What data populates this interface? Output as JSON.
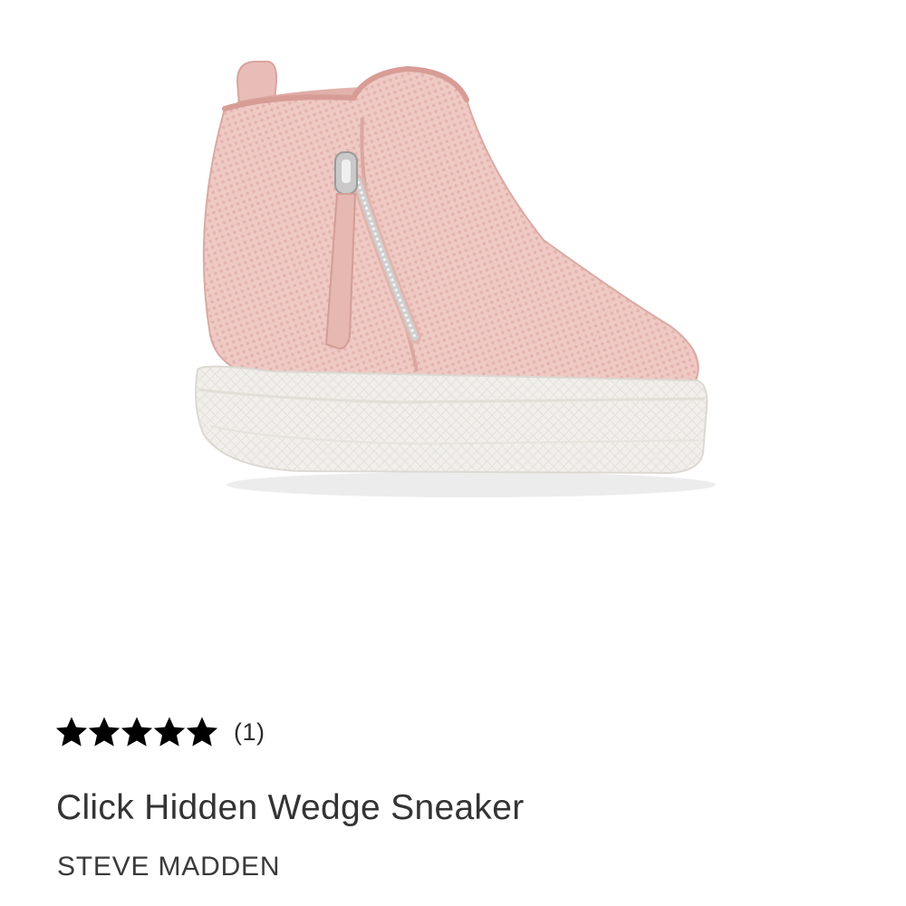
{
  "product": {
    "image_icon": "pink-wedge-sneaker-photo",
    "rating": {
      "value": 5,
      "max": 5,
      "icon": "star-icon",
      "review_count_label": "(1)"
    },
    "title": "Click Hidden Wedge Sneaker",
    "brand": "STEVE MADDEN"
  },
  "colors": {
    "background": "#ffffff",
    "shoe_knit": "#efc9c4",
    "shoe_sole": "#f2f0ec",
    "text": "#333333",
    "star": "#000000"
  }
}
